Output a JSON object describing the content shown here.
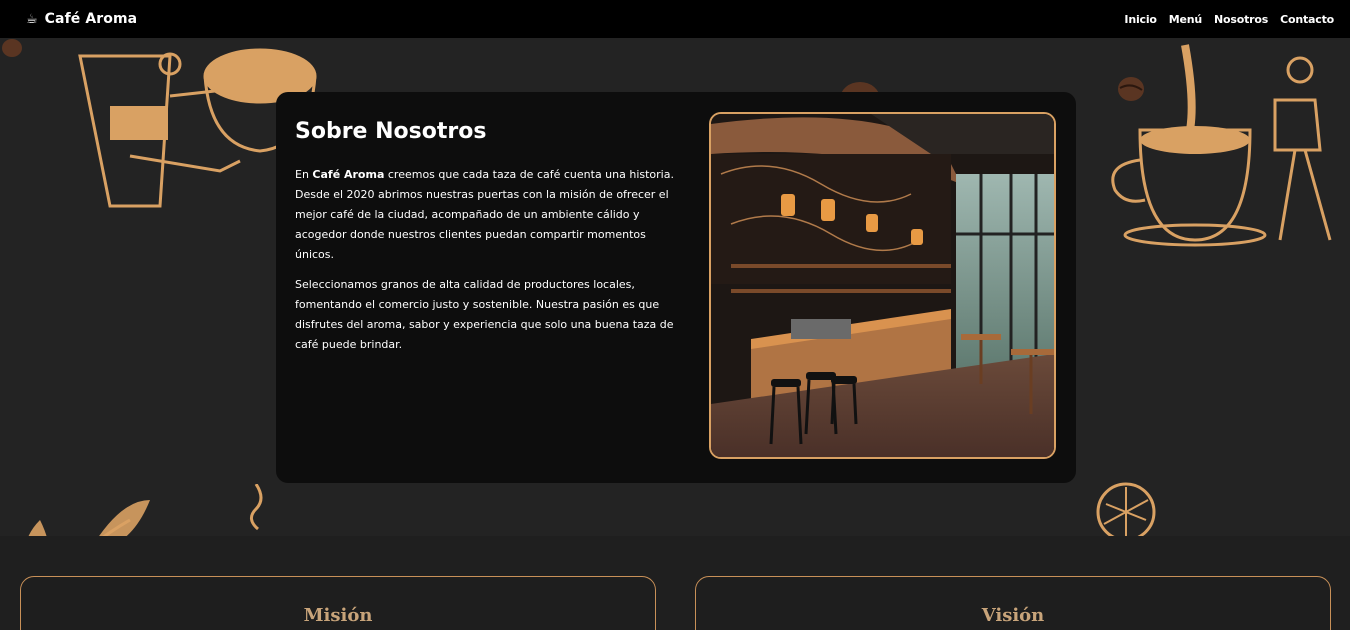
{
  "nav": {
    "brand_icon": "☕",
    "brand": "Café Aroma",
    "links": [
      "Inicio",
      "Menú",
      "Nosotros",
      "Contacto"
    ]
  },
  "about": {
    "title": "Sobre Nosotros",
    "p1_prefix": "En ",
    "p1_brand": "Café Aroma",
    "p1_rest": " creemos que cada taza de café cuenta una historia. Desde el 2020 abrimos nuestras puertas con la misión de ofrecer el mejor café de la ciudad, acompañado de un ambiente cálido y acogedor donde nuestros clientes puedan compartir momentos únicos.",
    "p2": "Seleccionamos granos de alta calidad de productores locales, fomentando el comercio justo y sostenible. Nuestra pasión es que disfrutes del aroma, sabor y experiencia que solo una buena taza de café puede brindar."
  },
  "cards": {
    "mision": "Misión",
    "vision": "Visión"
  },
  "colors": {
    "accent": "#d9a163",
    "background": "#232323",
    "card": "#0d0d0d",
    "navbar": "#000000"
  }
}
